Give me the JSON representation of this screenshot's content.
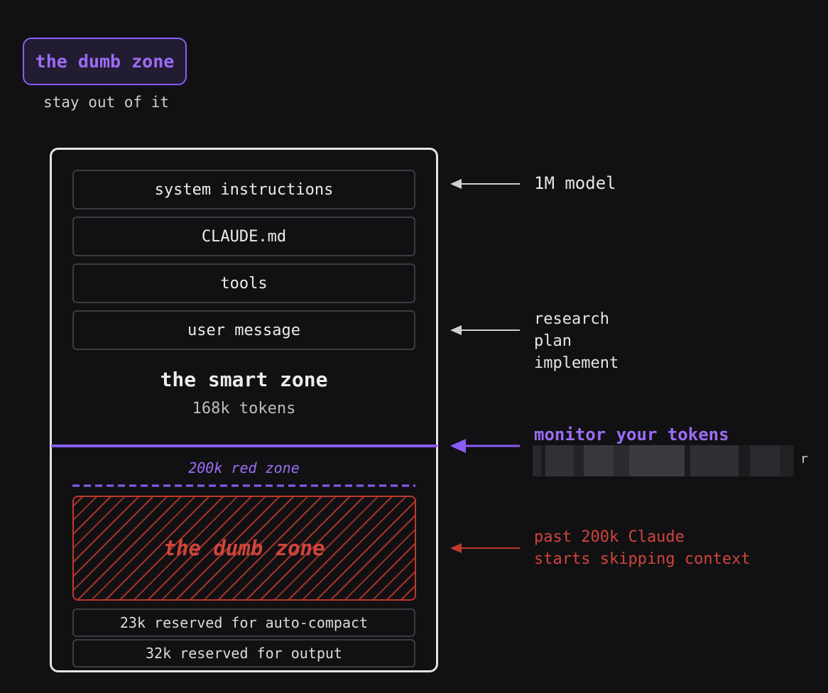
{
  "badge": {
    "title": "the dumb zone",
    "subtitle": "stay out of it"
  },
  "context_window": {
    "items": [
      {
        "label": "system instructions"
      },
      {
        "label": "CLAUDE.md"
      },
      {
        "label": "tools"
      },
      {
        "label": "user message"
      }
    ],
    "smart_zone": {
      "title": "the smart zone",
      "tokens": "168k tokens"
    },
    "red_zone_label": "200k red zone",
    "dumb_zone_label": "the dumb zone",
    "reserved": [
      {
        "label": "23k reserved for auto-compact"
      },
      {
        "label": "32k reserved for output"
      }
    ]
  },
  "annotations": {
    "model": "1M model",
    "workflow": [
      "research",
      "plan",
      "implement"
    ],
    "monitor": "monitor your tokens",
    "monitor_sub_tail": "r",
    "warning_line1": "past 200k Claude",
    "warning_line2": "starts skipping context"
  },
  "colors": {
    "accent_purple": "#8b5cf6",
    "danger_red": "#c0392b",
    "arrow_gray": "#cfcfcf",
    "background": "#111114"
  }
}
